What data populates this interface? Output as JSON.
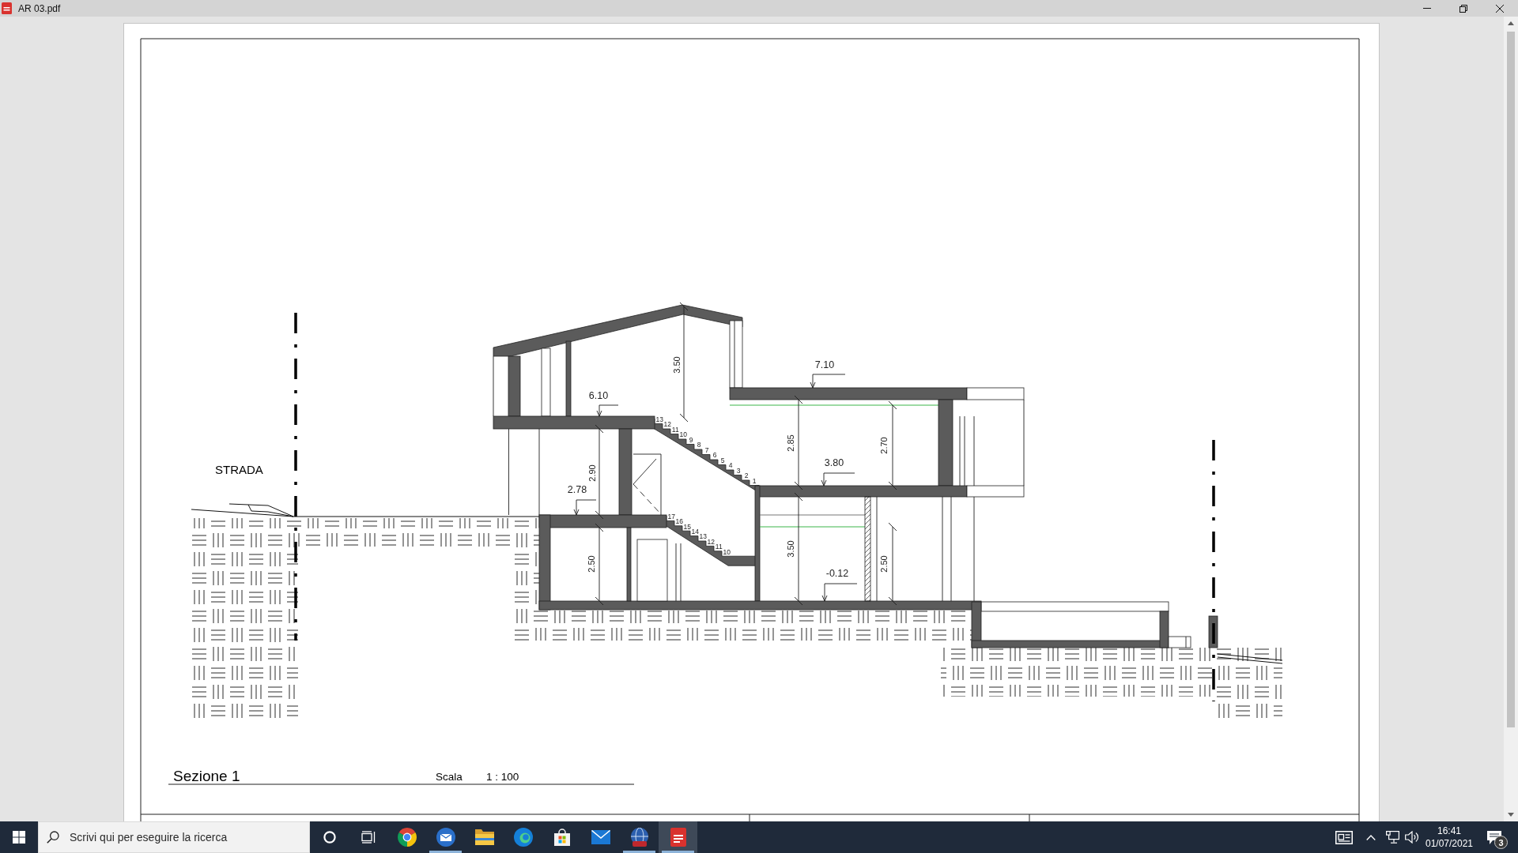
{
  "window": {
    "title": "AR 03.pdf"
  },
  "drawing": {
    "heights": [
      "3.50",
      "2.85",
      "2.70",
      "2.90",
      "2.50",
      "3.50",
      "2.50"
    ],
    "levels": [
      "7.10",
      "6.10",
      "3.80",
      "2.78",
      "-0.12"
    ],
    "upper_stair_steps": [
      "13",
      "12",
      "11",
      "10",
      "9",
      "8",
      "7",
      "6",
      "5",
      "4",
      "3",
      "2",
      "1"
    ],
    "lower_stair_steps": [
      "17",
      "16",
      "15",
      "14",
      "13",
      "12",
      "11",
      "10"
    ],
    "road_label": "STRADA"
  },
  "title_block": {
    "title": "Sezione 1",
    "scale_label": "Scala",
    "scale": "1 : 100"
  },
  "taskbar": {
    "search": {
      "placeholder": "Scrivi qui per eseguire la ricerca"
    },
    "buttons": [
      {
        "kind": "cortana",
        "running": false,
        "selected": false
      },
      {
        "kind": "task-view",
        "running": false,
        "selected": false
      },
      {
        "kind": "chrome",
        "running": false,
        "selected": false
      },
      {
        "kind": "thunderbird",
        "running": true,
        "selected": false
      },
      {
        "kind": "explorer",
        "running": false,
        "selected": false
      },
      {
        "kind": "edge",
        "running": false,
        "selected": false
      },
      {
        "kind": "store",
        "running": false,
        "selected": false
      },
      {
        "kind": "mail",
        "running": false,
        "selected": false
      },
      {
        "kind": "globe",
        "running": true,
        "selected": false
      },
      {
        "kind": "pdf",
        "running": true,
        "selected": true
      }
    ],
    "tray": {
      "time": "16:41",
      "date": "01/07/2021",
      "notification_count": "3"
    }
  }
}
